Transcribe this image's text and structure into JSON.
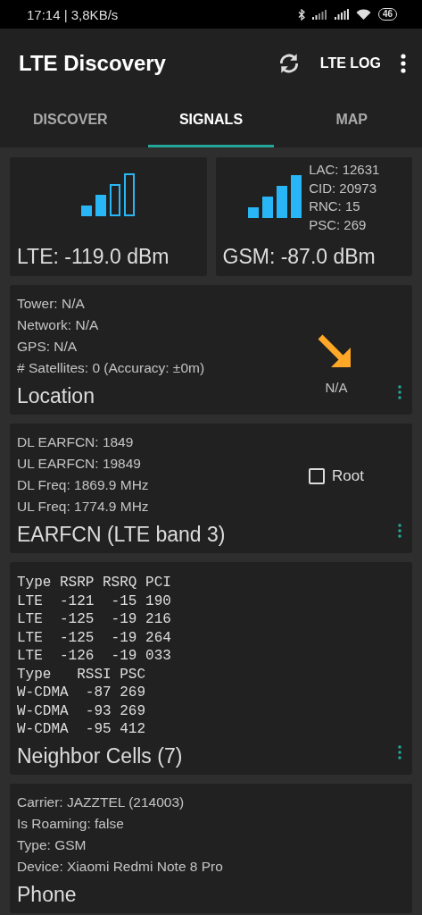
{
  "status_bar": {
    "text": "17:14 | 3,8KB/s",
    "battery": "46"
  },
  "app_bar": {
    "title": "LTE Discovery",
    "action": "LTE LOG"
  },
  "tabs": [
    {
      "label": "DISCOVER",
      "selected": false
    },
    {
      "label": "SIGNALS",
      "selected": true
    },
    {
      "label": "MAP",
      "selected": false
    }
  ],
  "signal_cards": [
    {
      "reading": "LTE: -119.0 dBm"
    },
    {
      "reading": "GSM: -87.0 dBm",
      "details": [
        "LAC: 12631",
        "CID: 20973",
        "RNC: 15",
        "PSC: 269"
      ]
    }
  ],
  "location": {
    "lines": [
      "Tower: N/A",
      "Network: N/A",
      "GPS: N/A",
      "# Satellites: 0 (Accuracy: ±0m)"
    ],
    "title": "Location",
    "direction": "N/A"
  },
  "earfcn": {
    "lines": [
      "DL EARFCN: 1849",
      "UL EARFCN: 19849",
      "DL Freq: 1869.9 MHz",
      "UL Freq: 1774.9 MHz"
    ],
    "title": "EARFCN (LTE band 3)",
    "root": {
      "label": "Root",
      "checked": false
    }
  },
  "neighbor_cells": {
    "lines": [
      "Type RSRP RSRQ PCI",
      "LTE  -121  -15 190",
      "LTE  -125  -19 216",
      "LTE  -125  -19 264",
      "LTE  -126  -19 033",
      "Type   RSSI PSC",
      "W-CDMA  -87 269",
      "W-CDMA  -93 269",
      "W-CDMA  -95 412"
    ],
    "title": "Neighbor Cells (7)"
  },
  "phone": {
    "lines": [
      "Carrier: JAZZTEL (214003)",
      "Is Roaming: false",
      "Type: GSM",
      "Device: Xiaomi Redmi Note 8 Pro"
    ],
    "title": "Phone"
  }
}
